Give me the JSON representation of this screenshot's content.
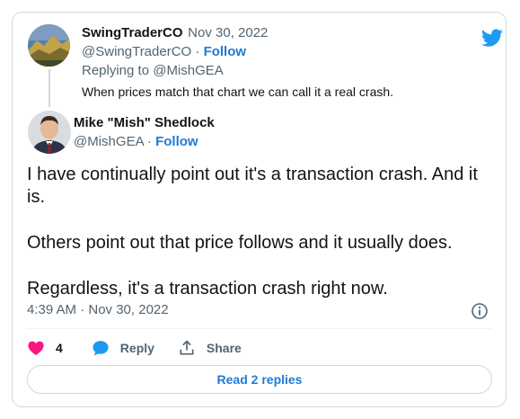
{
  "reply_tweet": {
    "display_name": "SwingTraderCO",
    "date": "Nov 30, 2022",
    "handle": "@SwingTraderCO",
    "follow_label": "Follow",
    "replying_to": "Replying to @MishGEA",
    "text": "When prices match that chart we can call it a real crash."
  },
  "main_tweet": {
    "display_name": "Mike \"Mish\" Shedlock",
    "handle": "@MishGEA",
    "follow_label": "Follow",
    "paragraphs": [
      "I have continually point out it's a transaction crash. And it is.",
      "Others point out that price follows and it usually does.",
      "Regardless, it's a transaction crash right now."
    ],
    "timestamp": "4:39 AM · Nov 30, 2022"
  },
  "actions": {
    "like_count": "4",
    "reply_label": "Reply",
    "share_label": "Share"
  },
  "read_replies_label": "Read 2 replies",
  "colors": {
    "accent": "#1d7bd6",
    "like": "#f91880",
    "twitter_blue": "#1d9bf0"
  },
  "icons": [
    "twitter-logo-icon",
    "heart-icon",
    "reply-bubble-icon",
    "share-icon",
    "info-icon"
  ]
}
